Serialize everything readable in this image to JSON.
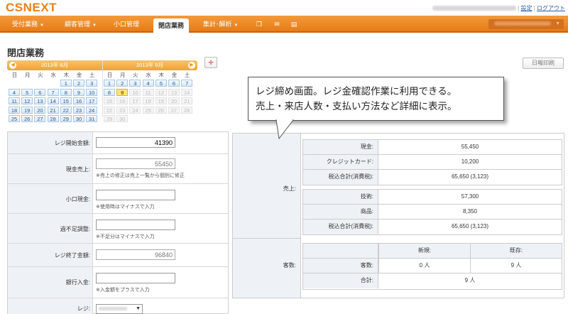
{
  "app": {
    "logo": "CSNEXT",
    "links": {
      "settings": "設定",
      "logout": "ログアウト"
    }
  },
  "nav": {
    "items": [
      {
        "label": "受付業務",
        "dropdown": true
      },
      {
        "label": "顧客管理",
        "dropdown": true
      },
      {
        "label": "小口管理",
        "dropdown": false
      },
      {
        "label": "閉店業務",
        "dropdown": false,
        "active": true
      },
      {
        "label": "集計･解析",
        "dropdown": true
      }
    ],
    "icons": [
      "copy-icon",
      "mail-icon",
      "document-icon"
    ]
  },
  "page": {
    "title": "閉店業務",
    "print_label": "日報印刷"
  },
  "calendar": {
    "months": [
      "2013年 8月",
      "2013年 9月"
    ],
    "weekdays": [
      "日",
      "月",
      "火",
      "水",
      "木",
      "金",
      "土"
    ],
    "today": "9"
  },
  "form": {
    "open_amount": {
      "label": "レジ開始金額:",
      "value": "41390"
    },
    "cash_sales": {
      "label": "現金売上:",
      "value": "55450",
      "note": "※売上の修正は売上一覧から個別に修正"
    },
    "petty_cash": {
      "label": "小口現金:",
      "value": "",
      "note": "※使用時はマイナスで入力"
    },
    "adjust": {
      "label": "過不足調整:",
      "value": "",
      "note": "※不足分はマイナスで入力"
    },
    "close_amount": {
      "label": "レジ終了金額:",
      "value": "96840"
    },
    "bank_deposit": {
      "label": "銀行入金:",
      "value": "",
      "note": "※入金額をプラスで入力"
    },
    "register": {
      "label": "レジ:"
    }
  },
  "sales": {
    "label": "売上:",
    "payment": [
      {
        "key": "現金:",
        "value": "55,450"
      },
      {
        "key": "クレジットカード:",
        "value": "10,200"
      },
      {
        "key": "税込合計(消費税):",
        "value": "65,650 (3,123)"
      }
    ],
    "category": [
      {
        "key": "技術:",
        "value": "57,300"
      },
      {
        "key": "商品:",
        "value": "8,350"
      },
      {
        "key": "税込合計(消費税):",
        "value": "65,650 (3,123)"
      }
    ]
  },
  "customers": {
    "label": "客数:",
    "head_new": "新規:",
    "head_existing": "既存:",
    "count_label": "客数:",
    "new_count": "0 人",
    "existing_count": "9 人",
    "total_label": "合計:",
    "total": "9 人"
  },
  "callout": {
    "line1": "レジ締め画面。レジ金確認作業に利用できる。",
    "line2": "売上・来店人数・支払い方法など詳細に表示。"
  }
}
